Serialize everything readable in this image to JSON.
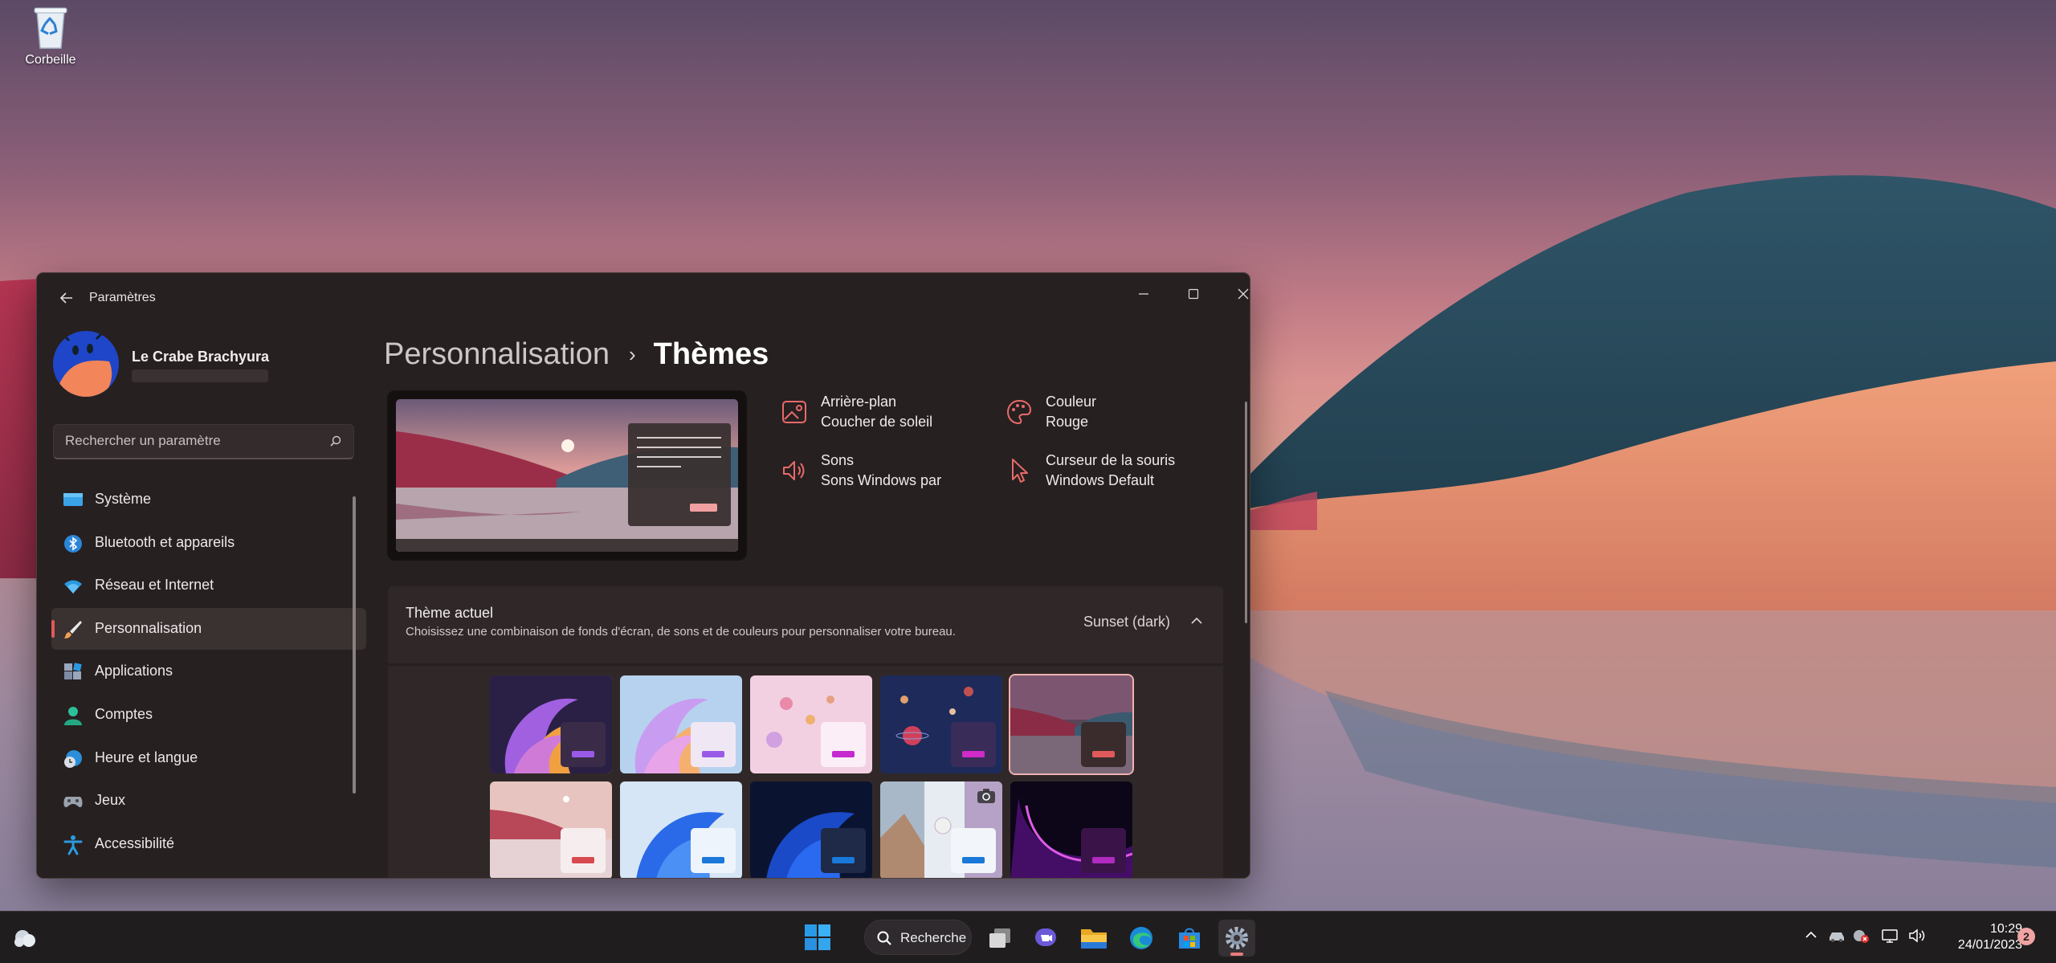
{
  "desktop": {
    "icons": [
      {
        "label": "Corbeille",
        "icon": "recycle-bin-icon"
      }
    ]
  },
  "window": {
    "title": "Paramètres",
    "controls": [
      "minimize-icon",
      "maximize-icon",
      "close-icon"
    ]
  },
  "profile": {
    "name": "Le Crabe Brachyura"
  },
  "search": {
    "placeholder": "Rechercher un paramètre"
  },
  "sidebar": {
    "items": [
      {
        "label": "Système",
        "icon": "system-icon"
      },
      {
        "label": "Bluetooth et appareils",
        "icon": "bluetooth-icon"
      },
      {
        "label": "Réseau et Internet",
        "icon": "wifi-icon"
      },
      {
        "label": "Personnalisation",
        "icon": "brush-icon",
        "selected": true
      },
      {
        "label": "Applications",
        "icon": "apps-icon"
      },
      {
        "label": "Comptes",
        "icon": "account-icon"
      },
      {
        "label": "Heure et langue",
        "icon": "clock-globe-icon"
      },
      {
        "label": "Jeux",
        "icon": "gamepad-icon"
      },
      {
        "label": "Accessibilité",
        "icon": "accessibility-icon"
      }
    ]
  },
  "breadcrumb": {
    "parent": "Personnalisation",
    "separator": "›",
    "current": "Thèmes"
  },
  "properties": {
    "background": {
      "title": "Arrière-plan",
      "value": "Coucher de soleil"
    },
    "color": {
      "title": "Couleur",
      "value": "Rouge"
    },
    "sounds": {
      "title": "Sons",
      "value": "Sons Windows par"
    },
    "cursor": {
      "title": "Curseur de la souris",
      "value": "Windows Default"
    }
  },
  "current_theme": {
    "title": "Thème actuel",
    "description": "Choisissez une combinaison de fonds d'écran, de sons et de couleurs pour personnaliser votre bureau.",
    "value": "Sunset (dark)"
  },
  "colors": {
    "accent": "#e05a5a",
    "window_bg": "#272020",
    "card_bg": "#302828"
  },
  "taskbar": {
    "search_label": "Recherche",
    "time": "10:29",
    "date": "24/01/2023",
    "notification_count": "2"
  }
}
